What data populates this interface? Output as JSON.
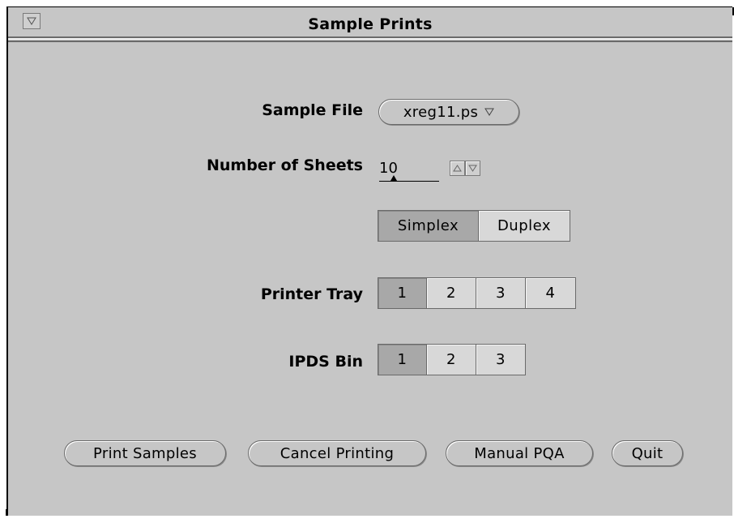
{
  "window": {
    "title": "Sample Prints"
  },
  "sample_file": {
    "label": "Sample File",
    "value": "xreg11.ps"
  },
  "number_of_sheets": {
    "label": "Number of Sheets",
    "value": "10"
  },
  "sides": {
    "options": [
      "Simplex",
      "Duplex"
    ],
    "selected": "Simplex"
  },
  "printer_tray": {
    "label": "Printer Tray",
    "options": [
      "1",
      "2",
      "3",
      "4"
    ],
    "selected": "1"
  },
  "ipds_bin": {
    "label": "IPDS Bin",
    "options": [
      "1",
      "2",
      "3"
    ],
    "selected": "1"
  },
  "actions": {
    "print_samples": "Print Samples",
    "cancel_printing": "Cancel Printing",
    "manual_pqa": "Manual PQA",
    "quit": "Quit"
  },
  "icons": {
    "window_menu": "triangle-down-icon",
    "dropdown": "triangle-down-icon",
    "spin_up": "triangle-up-icon",
    "spin_down": "triangle-down-icon"
  }
}
